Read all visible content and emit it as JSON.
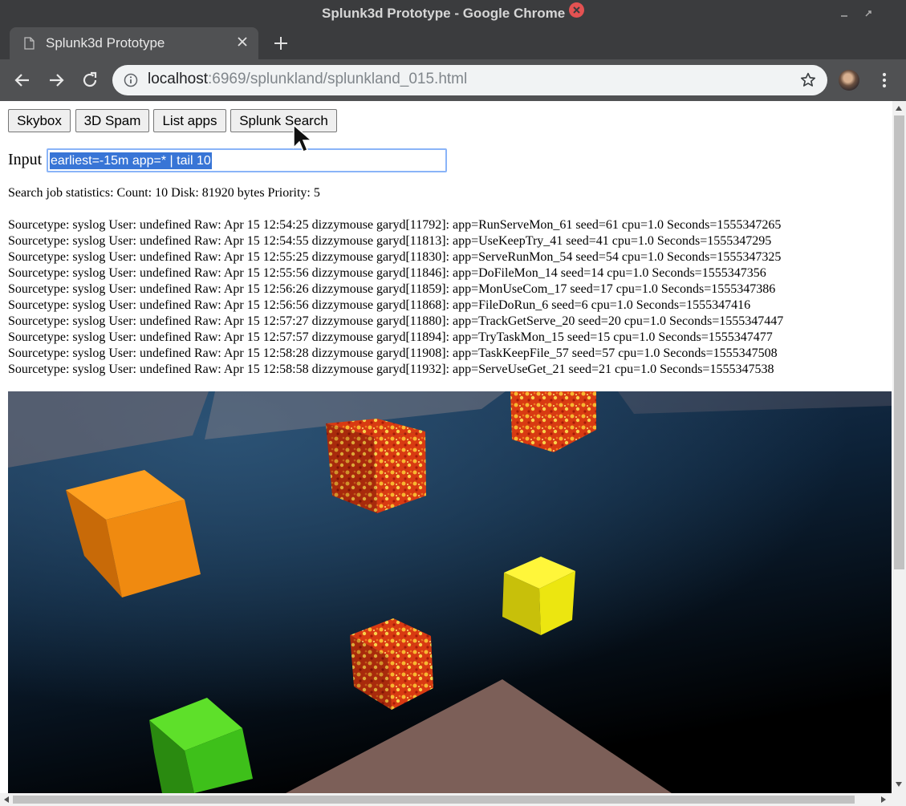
{
  "window": {
    "title": "Splunk3d Prototype - Google Chrome"
  },
  "tab": {
    "title": "Splunk3d Prototype"
  },
  "address_bar": {
    "host": "localhost",
    "rest": ":6969/splunkland/splunkland_015.html"
  },
  "buttons": {
    "skybox": "Skybox",
    "spam": "3D Spam",
    "list_apps": "List apps",
    "splunk_search": "Splunk Search"
  },
  "search": {
    "label": "Input",
    "query": "earliest=-15m app=* | tail 10"
  },
  "stats": "Search job statistics: Count: 10 Disk: 81920 bytes Priority: 5",
  "results": [
    "Sourcetype: syslog User: undefined Raw: Apr 15 12:54:25 dizzymouse garyd[11792]: app=RunServeMon_61 seed=61 cpu=1.0 Seconds=1555347265",
    "Sourcetype: syslog User: undefined Raw: Apr 15 12:54:55 dizzymouse garyd[11813]: app=UseKeepTry_41 seed=41 cpu=1.0 Seconds=1555347295",
    "Sourcetype: syslog User: undefined Raw: Apr 15 12:55:25 dizzymouse garyd[11830]: app=ServeRunMon_54 seed=54 cpu=1.0 Seconds=1555347325",
    "Sourcetype: syslog User: undefined Raw: Apr 15 12:55:56 dizzymouse garyd[11846]: app=DoFileMon_14 seed=14 cpu=1.0 Seconds=1555347356",
    "Sourcetype: syslog User: undefined Raw: Apr 15 12:56:26 dizzymouse garyd[11859]: app=MonUseCom_17 seed=17 cpu=1.0 Seconds=1555347386",
    "Sourcetype: syslog User: undefined Raw: Apr 15 12:56:56 dizzymouse garyd[11868]: app=FileDoRun_6 seed=6 cpu=1.0 Seconds=1555347416",
    "Sourcetype: syslog User: undefined Raw: Apr 15 12:57:27 dizzymouse garyd[11880]: app=TrackGetServe_20 seed=20 cpu=1.0 Seconds=1555347447",
    "Sourcetype: syslog User: undefined Raw: Apr 15 12:57:57 dizzymouse garyd[11894]: app=TryTaskMon_15 seed=15 cpu=1.0 Seconds=1555347477",
    "Sourcetype: syslog User: undefined Raw: Apr 15 12:58:28 dizzymouse garyd[11908]: app=TaskKeepFile_57 seed=57 cpu=1.0 Seconds=1555347508",
    "Sourcetype: syslog User: undefined Raw: Apr 15 12:58:58 dizzymouse garyd[11932]: app=ServeUseGet_21 seed=21 cpu=1.0 Seconds=1555347538"
  ],
  "scene": {
    "cubes": [
      {
        "name": "orange-cube",
        "color": "#f08a10"
      },
      {
        "name": "lava-cube",
        "color": "#e0501a"
      },
      {
        "name": "lava-cube",
        "color": "#e0501a"
      },
      {
        "name": "yellow-cube",
        "color": "#f2ea10"
      },
      {
        "name": "lava-cube",
        "color": "#e0501a"
      },
      {
        "name": "green-cube",
        "color": "#3ec01a"
      }
    ]
  }
}
